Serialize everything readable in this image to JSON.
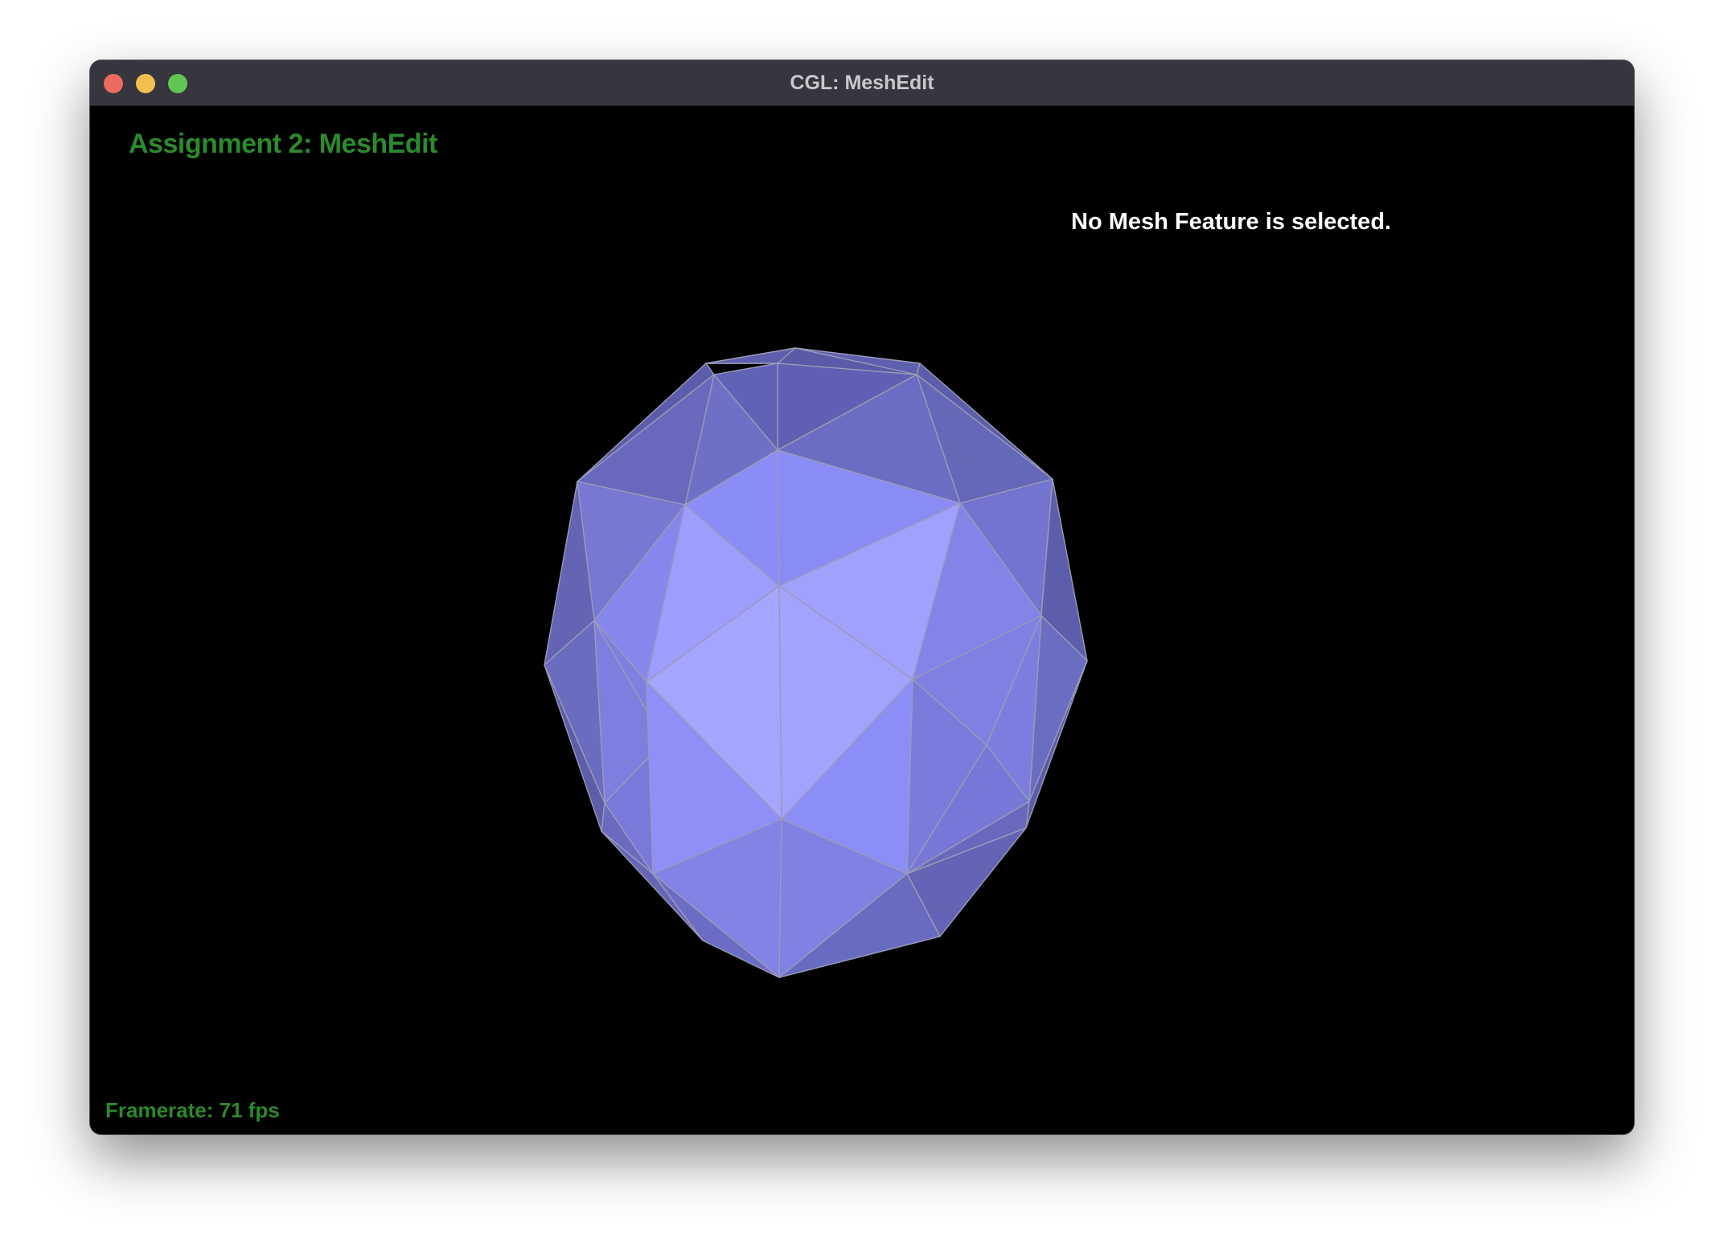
{
  "window": {
    "title": "CGL: MeshEdit"
  },
  "app": {
    "title": "Assignment 2: MeshEdit",
    "selection_status": "No Mesh Feature is selected.",
    "framerate": "Framerate: 71 fps"
  },
  "colors": {
    "titlebar": "#37353d",
    "viewport_background": "#000000",
    "app_title_text": "#2b8a2b",
    "mesh_base": "#8a8cf5",
    "mesh_edge": "#9a9ab8"
  },
  "icons": {
    "close": "close-traffic-light-icon",
    "minimize": "minimize-traffic-light-icon",
    "zoom": "zoom-traffic-light-icon"
  }
}
